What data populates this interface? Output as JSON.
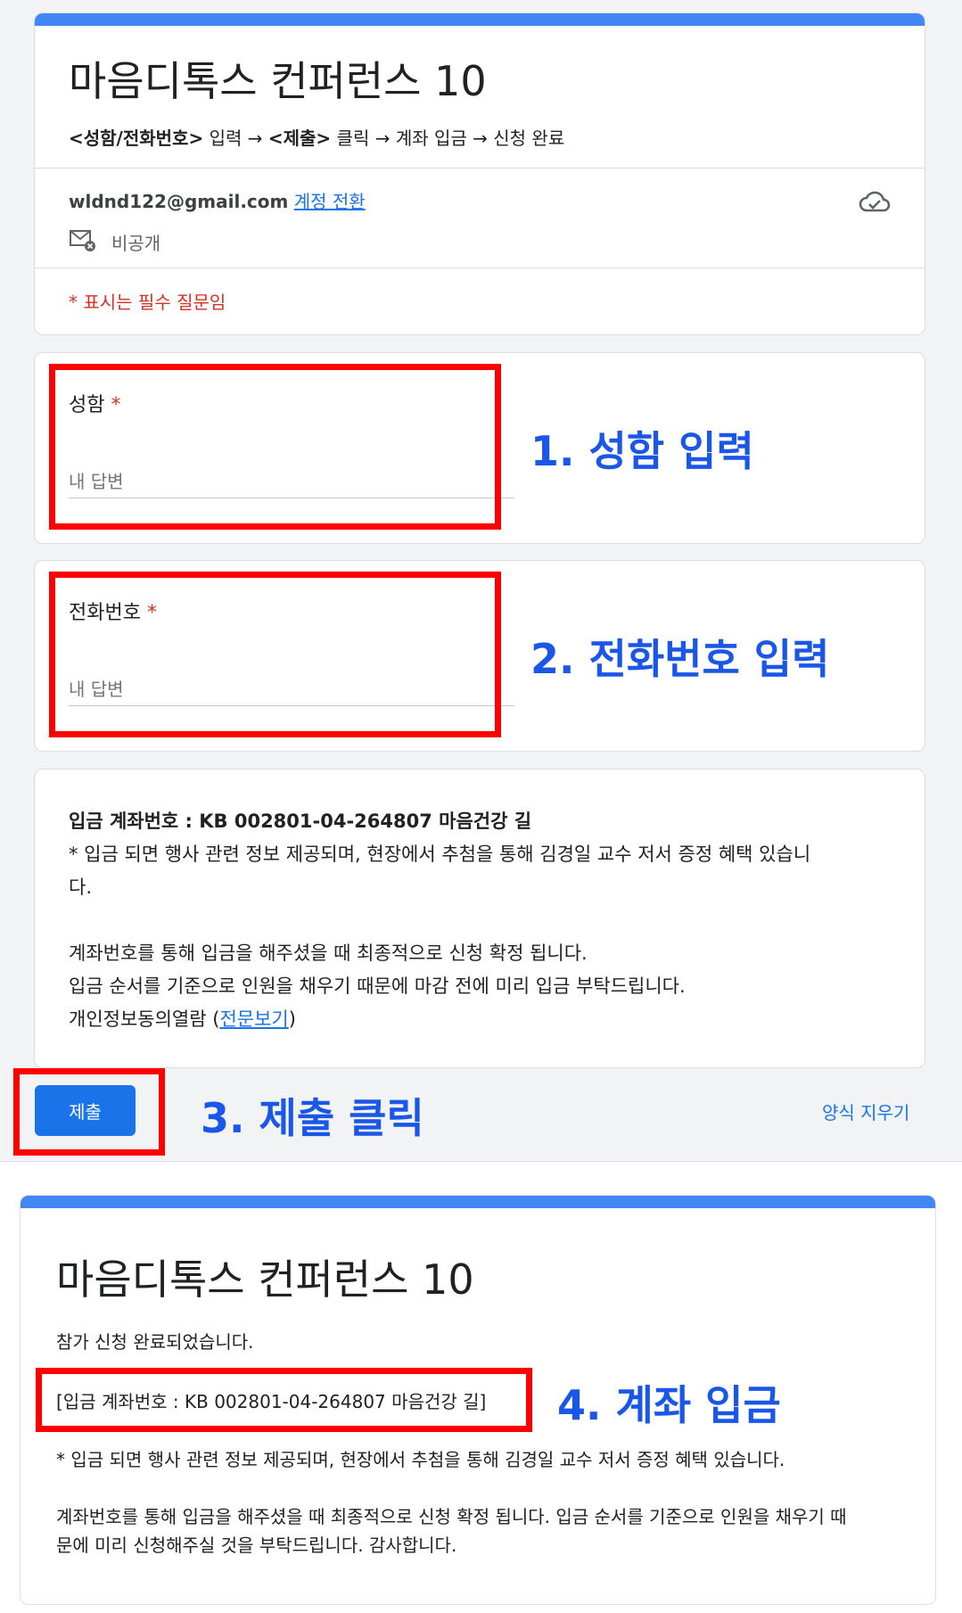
{
  "form": {
    "title": "마음디톡스 컨퍼런스 10",
    "instruction_parts": {
      "a": "<성함/전화번호>",
      "b": " 입력 → ",
      "c": "<제출>",
      "d": " 클릭 → 계좌 입금 → 신청 완료"
    },
    "email": "wldnd122@gmail.com",
    "switch_account": "계정 전환",
    "private_label": "비공개",
    "required_note": "* 표시는 필수 질문임"
  },
  "questions": [
    {
      "label": "성함",
      "required_mark": "*",
      "placeholder": "내 답변"
    },
    {
      "label": "전화번호",
      "required_mark": "*",
      "placeholder": "내 답변"
    }
  ],
  "info": {
    "account_line": "입금 계좌번호 : KB 002801-04-264807 마음건강 길",
    "benefit_line1": "* 입금 되면 행사 관련 정보 제공되며, 현장에서 추첨을 통해 김경일 교수 저서 증정 혜택 있습니",
    "benefit_line2": "다.",
    "confirm_line": "계좌번호를 통해 입금을 해주셨을 때 최종적으로 신청 확정 됩니다.",
    "order_line": "입금 순서를 기준으로 인원을 채우기 때문에 마감 전에 미리 입금 부탁드립니다.",
    "privacy_prefix": "개인정보동의열람 (",
    "privacy_link": "전문보기",
    "privacy_suffix": ")"
  },
  "actions": {
    "submit_label": "제출",
    "clear_label": "양식 지우기"
  },
  "callouts": {
    "step1": "1. 성함 입력",
    "step2": "2. 전화번호 입력",
    "step3": "3. 제출 클릭",
    "step4": "4. 계좌 입금"
  },
  "confirmation": {
    "title": "마음디톡스 컨퍼런스 10",
    "done": "참가 신청 완료되었습니다.",
    "account_line": "[입금 계좌번호 : KB 002801-04-264807 마음건강 길]",
    "benefit_line": "* 입금 되면 행사 관련 정보 제공되며, 현장에서 추첨을 통해 김경일 교수 저서 증정 혜택 있습니다.",
    "confirm_line1": "계좌번호를 통해 입금을 해주셨을 때 최종적으로 신청 확정 됩니다. 입금 순서를 기준으로 인원을 채우기 때",
    "confirm_line2": "문에 미리 신청해주실 것을 부탁드립니다. 감사합니다."
  },
  "colors": {
    "accent": "#4285f4",
    "callout": "#1a56e8",
    "highlight": "#ff0000",
    "submit": "#1a73e8"
  }
}
